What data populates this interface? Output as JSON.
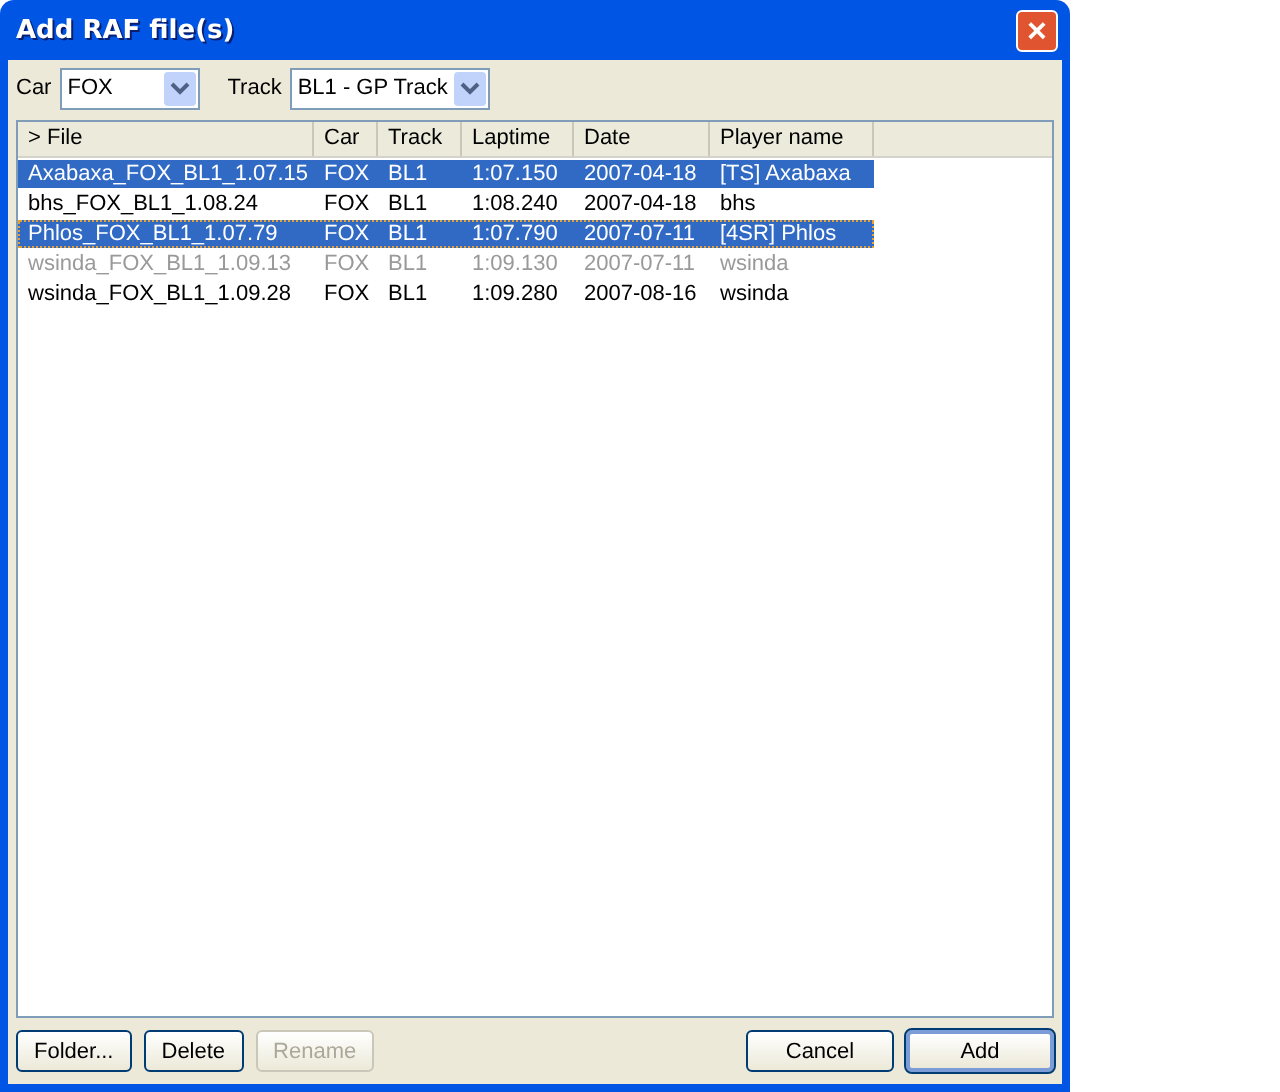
{
  "window": {
    "title": "Add RAF file(s)",
    "close": "×"
  },
  "filters": [
    {
      "label": "Car",
      "value": "FOX"
    },
    {
      "label": "Track",
      "value": "BL1 - GP Track"
    }
  ],
  "table": {
    "columns": [
      "> File",
      "Car",
      "Track",
      "Laptime",
      "Date",
      "Player name"
    ],
    "rows": [
      {
        "cells": [
          "Axabaxa_FOX_BL1_1.07.15",
          "FOX",
          "BL1",
          "1:07.150",
          "2007-04-18",
          "[TS] Axabaxa"
        ],
        "selected": true,
        "disabled": false,
        "focused": false
      },
      {
        "cells": [
          "bhs_FOX_BL1_1.08.24",
          "FOX",
          "BL1",
          "1:08.240",
          "2007-04-18",
          "bhs"
        ],
        "selected": false,
        "disabled": false,
        "focused": false
      },
      {
        "cells": [
          "Phlos_FOX_BL1_1.07.79",
          "FOX",
          "BL1",
          "1:07.790",
          "2007-07-11",
          "[4SR] Phlos"
        ],
        "selected": true,
        "disabled": false,
        "focused": true
      },
      {
        "cells": [
          "wsinda_FOX_BL1_1.09.13",
          "FOX",
          "BL1",
          "1:09.130",
          "2007-07-11",
          "wsinda"
        ],
        "selected": false,
        "disabled": true,
        "focused": false
      },
      {
        "cells": [
          "wsinda_FOX_BL1_1.09.28",
          "FOX",
          "BL1",
          "1:09.280",
          "2007-08-16",
          "wsinda"
        ],
        "selected": false,
        "disabled": false,
        "focused": false
      }
    ]
  },
  "left_buttons": [
    {
      "label": "Folder...",
      "disabled": false
    },
    {
      "label": "Delete",
      "disabled": false
    },
    {
      "label": "Rename",
      "disabled": true
    }
  ],
  "right_buttons": [
    {
      "label": "Cancel",
      "default": false
    },
    {
      "label": "Add",
      "default": true
    }
  ]
}
